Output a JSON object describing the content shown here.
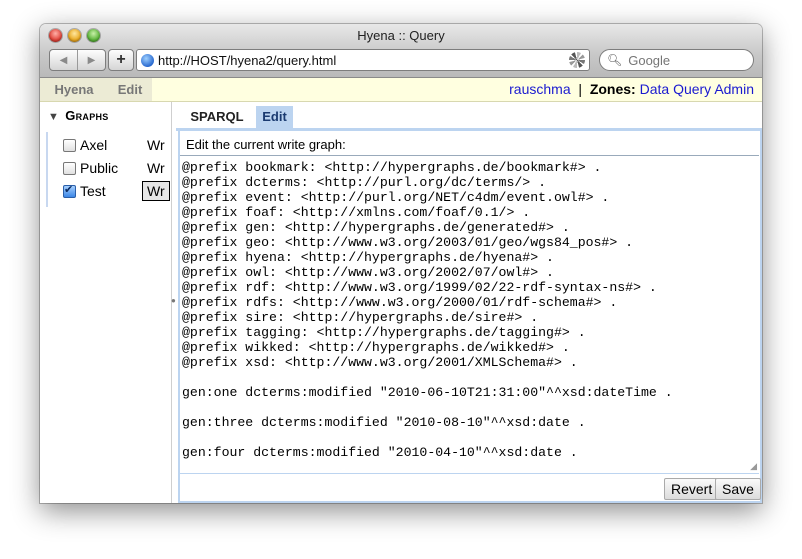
{
  "window": {
    "title": "Hyena :: Query"
  },
  "toolbar": {
    "back_label": "◀",
    "forward_label": "▶",
    "add_label": "+",
    "url": "http://HOST/hyena2/query.html",
    "search_placeholder": "Google"
  },
  "topnav": {
    "hyena_label": "Hyena",
    "edit_label": "Edit",
    "user": "rauschma",
    "separator": "|",
    "zones_label": "Zones:",
    "zones": [
      "Data",
      "Query",
      "Admin"
    ]
  },
  "sidebar": {
    "heading": "Graphs",
    "items": [
      {
        "name": "Axel",
        "checked": false,
        "perm": "Wr"
      },
      {
        "name": "Public",
        "checked": false,
        "perm": "Wr"
      },
      {
        "name": "Test",
        "checked": true,
        "perm": "Wr",
        "selected": true
      }
    ]
  },
  "tabs": {
    "sparql": "SPARQL",
    "edit": "Edit"
  },
  "panel": {
    "label": "Edit the current write graph:",
    "content": "@prefix bookmark: <http://hypergraphs.de/bookmark#> .\n@prefix dcterms: <http://purl.org/dc/terms/> .\n@prefix event: <http://purl.org/NET/c4dm/event.owl#> .\n@prefix foaf: <http://xmlns.com/foaf/0.1/> .\n@prefix gen: <http://hypergraphs.de/generated#> .\n@prefix geo: <http://www.w3.org/2003/01/geo/wgs84_pos#> .\n@prefix hyena: <http://hypergraphs.de/hyena#> .\n@prefix owl: <http://www.w3.org/2002/07/owl#> .\n@prefix rdf: <http://www.w3.org/1999/02/22-rdf-syntax-ns#> .\n@prefix rdfs: <http://www.w3.org/2000/01/rdf-schema#> .\n@prefix sire: <http://hypergraphs.de/sire#> .\n@prefix tagging: <http://hypergraphs.de/tagging#> .\n@prefix wikked: <http://hypergraphs.de/wikked#> .\n@prefix xsd: <http://www.w3.org/2001/XMLSchema#> .\n\ngen:one dcterms:modified \"2010-06-10T21:31:00\"^^xsd:dateTime .\n\ngen:three dcterms:modified \"2010-08-10\"^^xsd:date .\n\ngen:four dcterms:modified \"2010-04-10\"^^xsd:date .",
    "revert_label": "Revert",
    "save_label": "Save"
  }
}
